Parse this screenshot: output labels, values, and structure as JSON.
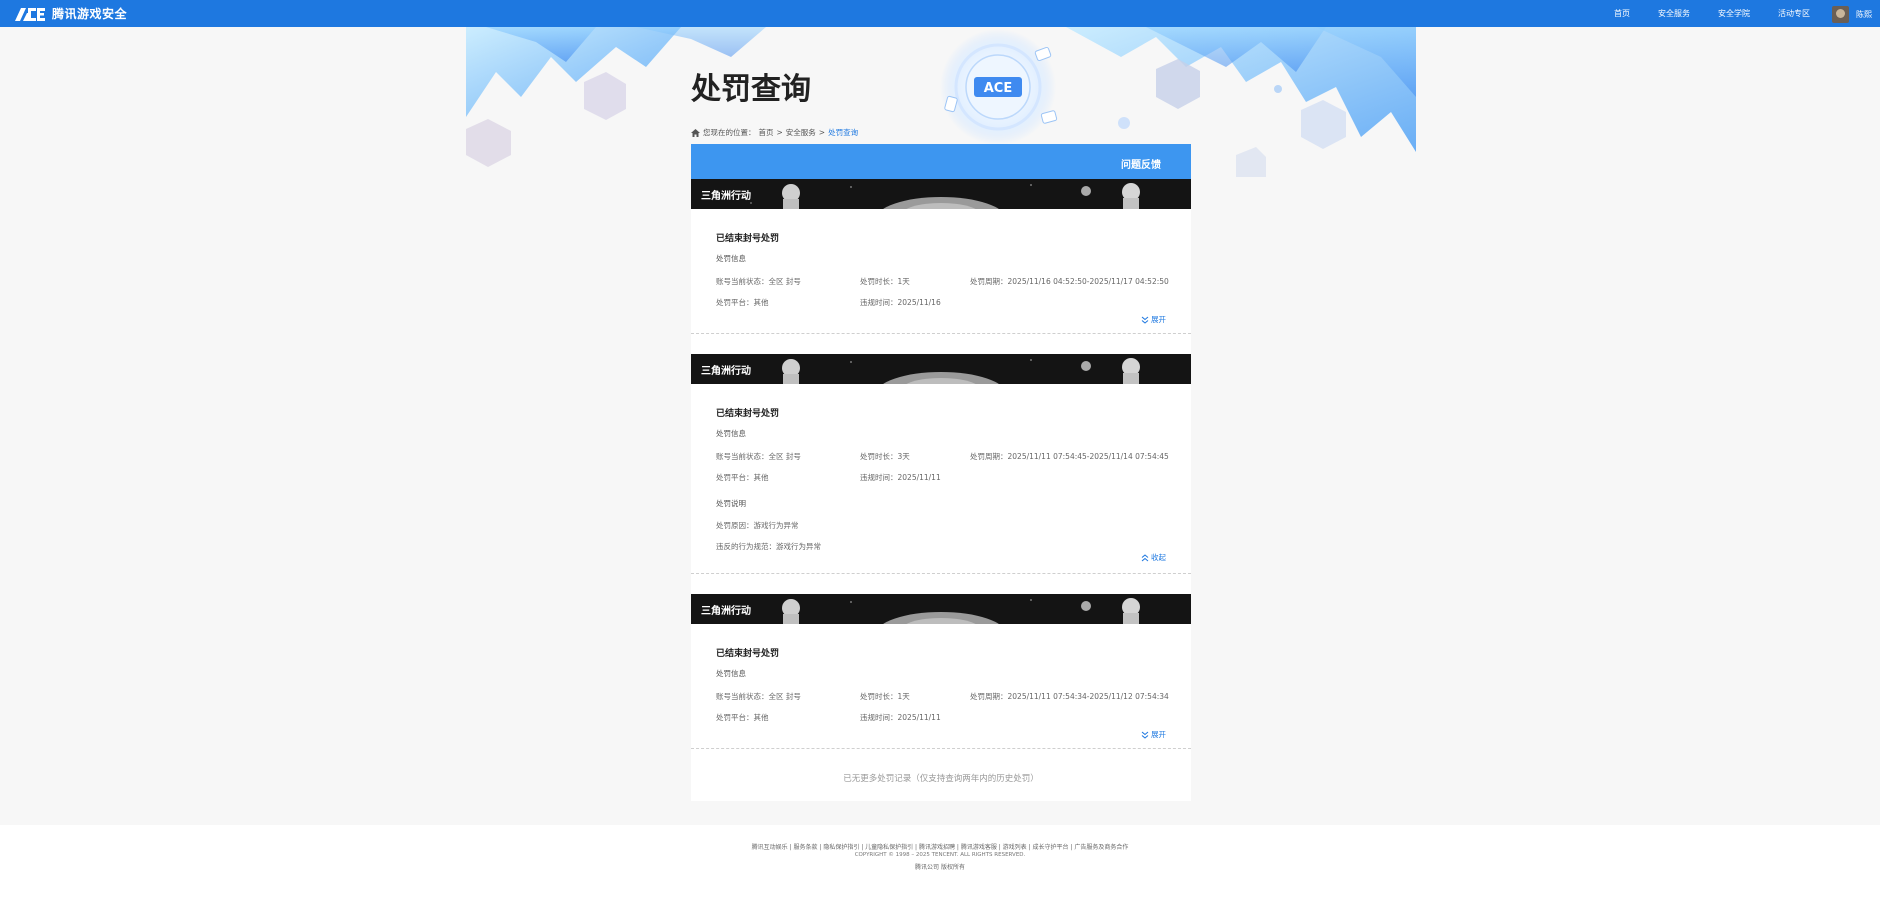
{
  "header": {
    "logo_text": "腾讯游戏安全",
    "nav": [
      "首页",
      "安全服务",
      "安全学院",
      "活动专区"
    ],
    "username": "陈熙"
  },
  "page": {
    "title": "处罚查询",
    "breadcrumb": {
      "prefix": "您现在的位置：",
      "items": [
        "首页",
        "安全服务",
        "处罚查询"
      ],
      "separator": ">"
    },
    "feedback_label": "问题反馈"
  },
  "records": [
    {
      "game": "三角洲行动",
      "title": "已结束封号处罚",
      "section_label": "处罚信息",
      "status": "账号当前状态：全区 封号",
      "duration": "处罚时长：1天",
      "period": "处罚周期：2025/11/16 04:52:50-2025/11/17 04:52:50",
      "platform": "处罚平台：其他",
      "violation_time": "违规时间：2025/11/16",
      "toggle": "展开",
      "expanded": false
    },
    {
      "game": "三角洲行动",
      "title": "已结束封号处罚",
      "section_label": "处罚信息",
      "status": "账号当前状态：全区 封号",
      "duration": "处罚时长：3天",
      "period": "处罚周期：2025/11/11 07:54:45-2025/11/14 07:54:45",
      "platform": "处罚平台：其他",
      "violation_time": "违规时间：2025/11/11",
      "explain_label": "处罚说明",
      "reason": "处罚原因：游戏行为异常",
      "rule": "违反的行为规范：游戏行为异常",
      "toggle": "收起",
      "expanded": true
    },
    {
      "game": "三角洲行动",
      "title": "已结束封号处罚",
      "section_label": "处罚信息",
      "status": "账号当前状态：全区 封号",
      "duration": "处罚时长：1天",
      "period": "处罚周期：2025/11/11 07:54:34-2025/11/12 07:54:34",
      "platform": "处罚平台：其他",
      "violation_time": "违规时间：2025/11/11",
      "toggle": "展开",
      "expanded": false
    }
  ],
  "no_more": "已无更多处罚记录（仅支持查询两年内的历史处罚）",
  "footer": {
    "links": "腾讯互动娱乐 | 服务条款 | 隐私保护指引 | 儿童隐私保护指引 | 腾讯游戏招聘 | 腾讯游戏客服 | 游戏列表 | 成长守护平台 | 广告服务及商务合作",
    "copyright": "COPYRIGHT © 1998 – 2025 TENCENT. ALL RIGHTS RESERVED.",
    "extra": "腾讯公司 版权所有"
  },
  "colors": {
    "brand": "#1e78e0",
    "panel_head": "#3d96f0",
    "link": "#1e78e0"
  },
  "icons": {
    "home": "home-icon",
    "expand": "chevron-double-down-icon",
    "collapse": "chevron-double-up-icon"
  }
}
